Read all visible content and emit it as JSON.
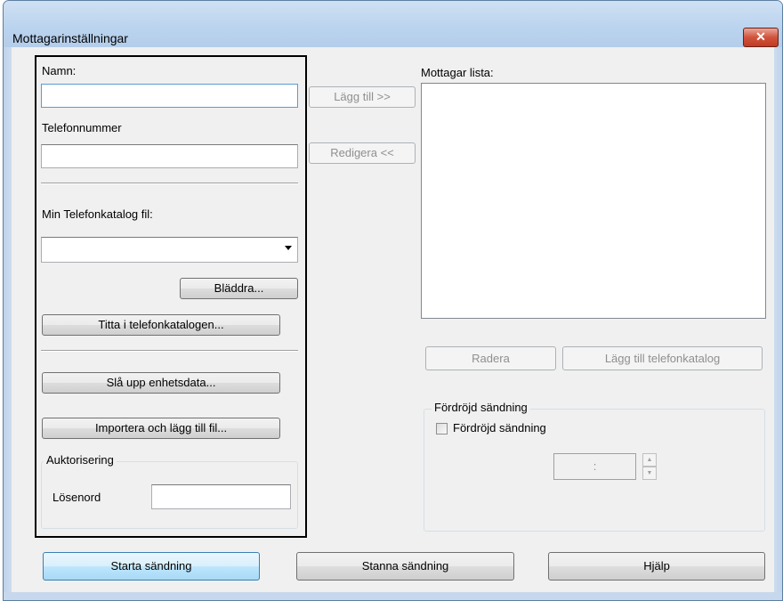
{
  "window": {
    "title": "Mottagarinställningar",
    "close_glyph": "✕"
  },
  "left": {
    "name_label": "Namn:",
    "name_value": "",
    "phone_label": "Telefonnummer",
    "phone_value": "",
    "phonebook_file_label": "Min Telefonkatalog fil:",
    "phonebook_file_value": "",
    "browse_button": "Bläddra...",
    "view_phonebook_button": "Titta i telefonkatalogen...",
    "lookup_device_button": "Slå upp enhetsdata...",
    "import_button": "Importera och lägg till fil...",
    "auth_group": "Auktorisering",
    "password_label": "Lösenord",
    "password_value": ""
  },
  "middle": {
    "add_button": "Lägg till  >>",
    "edit_button": "Redigera <<"
  },
  "right": {
    "recipient_list_label": "Mottagar lista:",
    "recipient_list_items": [],
    "delete_button": "Radera",
    "add_to_phonebook_button": "Lägg till telefonkatalog",
    "delayed_group": "Fördröjd sändning",
    "delayed_checkbox_label": "Fördröjd sändning",
    "delayed_checked": false,
    "time_value": ":"
  },
  "footer": {
    "start_button": "Starta sändning",
    "stop_button": "Stanna sändning",
    "help_button": "Hjälp"
  },
  "colors": {
    "titlebar": "#bad3ee",
    "close": "#c23a23",
    "dialog_bg": "#f0f0f0",
    "focus_border": "#5b9bd5"
  },
  "icons": {
    "close": "close-icon",
    "dropdown": "chevron-down-icon",
    "spin_up": "spin-up-icon",
    "spin_down": "spin-down-icon"
  }
}
